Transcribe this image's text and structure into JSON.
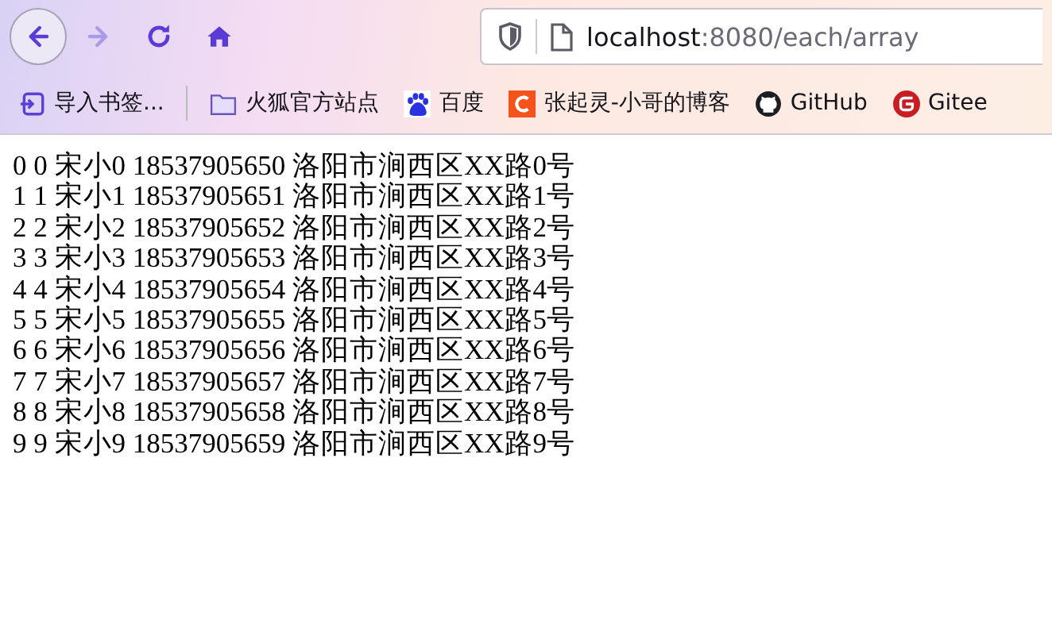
{
  "toolbar": {
    "nav_buttons": [
      {
        "kind": "back",
        "disabled": false
      },
      {
        "kind": "forward",
        "disabled": true
      },
      {
        "kind": "reload",
        "disabled": false
      },
      {
        "kind": "home",
        "disabled": false
      }
    ],
    "address": {
      "host": "localhost",
      "path": ":8080/each/array"
    }
  },
  "bookmarks": [
    {
      "kind": "import",
      "label": "导入书签..."
    },
    {
      "kind": "folder",
      "label": "火狐官方站点"
    },
    {
      "kind": "paw",
      "label": "百度"
    },
    {
      "kind": "csdn",
      "label": "张起灵-小哥的博客"
    },
    {
      "kind": "github",
      "label": "GitHub"
    },
    {
      "kind": "gitee",
      "label": "Gitee"
    }
  ],
  "lines": [
    "0 0 宋小0 18537905650 洛阳市涧西区XX路0号",
    "1 1 宋小1 18537905651 洛阳市涧西区XX路1号",
    "2 2 宋小2 18537905652 洛阳市涧西区XX路2号",
    "3 3 宋小3 18537905653 洛阳市涧西区XX路3号",
    "4 4 宋小4 18537905654 洛阳市涧西区XX路4号",
    "5 5 宋小5 18537905655 洛阳市涧西区XX路5号",
    "6 6 宋小6 18537905656 洛阳市涧西区XX路6号",
    "7 7 宋小7 18537905657 洛阳市涧西区XX路7号",
    "8 8 宋小8 18537905658 洛阳市涧西区XX路8号",
    "9 9 宋小9 18537905659 洛阳市涧西区XX路9号"
  ]
}
